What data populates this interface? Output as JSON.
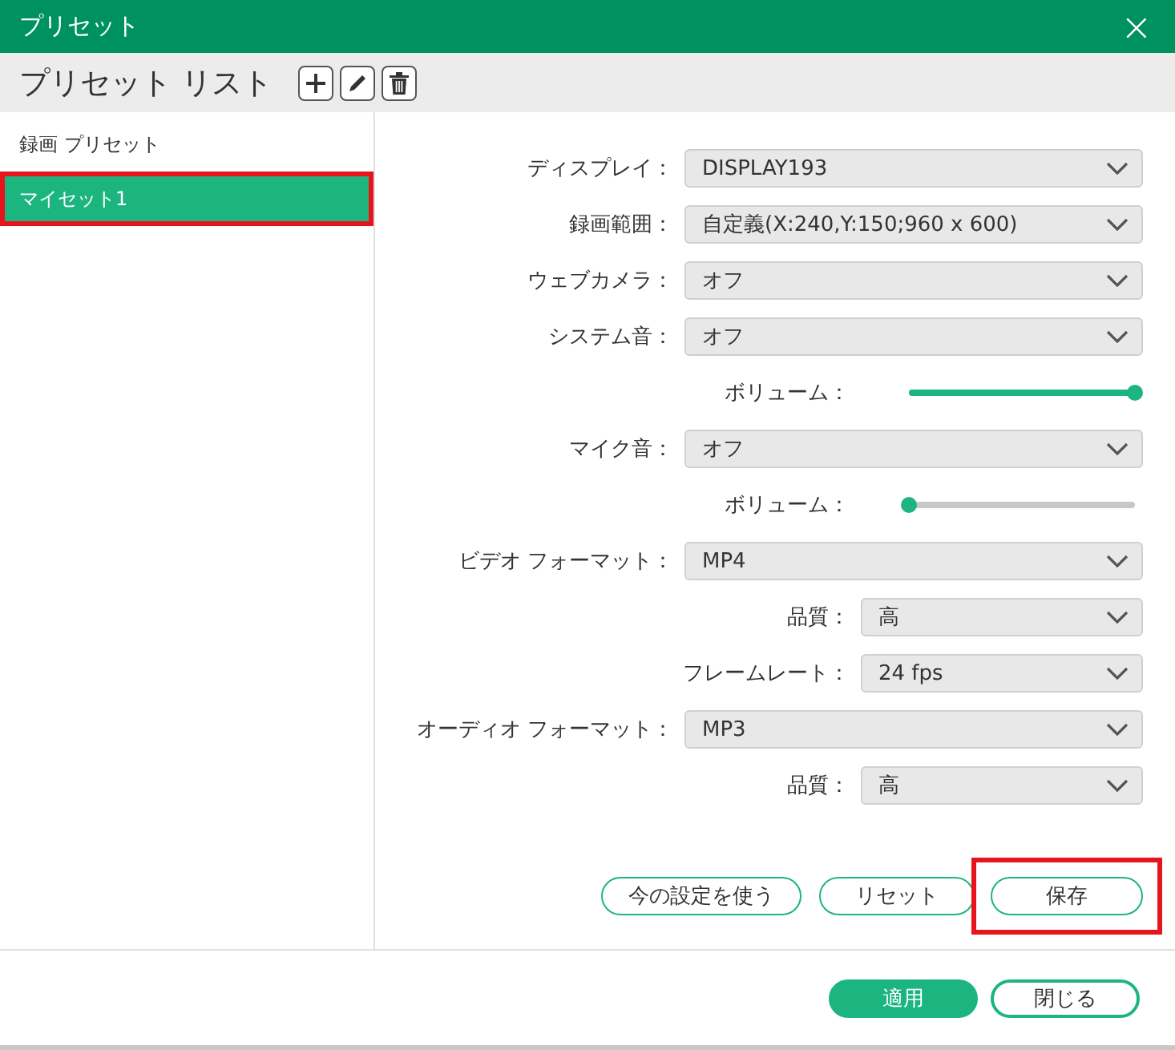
{
  "window": {
    "title": "プリセット",
    "close": "×"
  },
  "toolbar": {
    "title": "プリセット リスト"
  },
  "presets": [
    {
      "label": "録画 プリセット",
      "selected": false,
      "highlighted": false
    },
    {
      "label": "マイセット1",
      "selected": true,
      "highlighted": true
    }
  ],
  "settings": [
    {
      "kind": "select",
      "label": "ディスプレイ：",
      "value": "DISPLAY193"
    },
    {
      "kind": "select",
      "label": "録画範囲：",
      "value": "自定義(X:240,Y:150;960 x 600)"
    },
    {
      "kind": "select",
      "label": "ウェブカメラ：",
      "value": "オフ"
    },
    {
      "kind": "select",
      "label": "システム音：",
      "value": "オフ"
    },
    {
      "kind": "slider",
      "label": "ボリューム：",
      "level": 1
    },
    {
      "kind": "select",
      "label": "マイク音：",
      "value": "オフ"
    },
    {
      "kind": "slider",
      "label": "ボリューム：",
      "level": 0
    },
    {
      "kind": "select",
      "label": "ビデオ フォーマット：",
      "value": "MP4"
    },
    {
      "kind": "subselect",
      "label": "品質：",
      "value": "高"
    },
    {
      "kind": "subselect",
      "label": "フレームレート：",
      "value": "24 fps"
    },
    {
      "kind": "select",
      "label": "オーディオ フォーマット：",
      "value": "MP3"
    },
    {
      "kind": "subselect",
      "label": "品質：",
      "value": "高"
    }
  ],
  "actions": [
    {
      "label": "今の設定を使う",
      "highlighted": false
    },
    {
      "label": "リセット",
      "highlighted": false
    },
    {
      "label": "保存",
      "highlighted": true
    }
  ],
  "footer": [
    {
      "label": "適用",
      "primary": true
    },
    {
      "label": "閉じる",
      "primary": false
    }
  ]
}
